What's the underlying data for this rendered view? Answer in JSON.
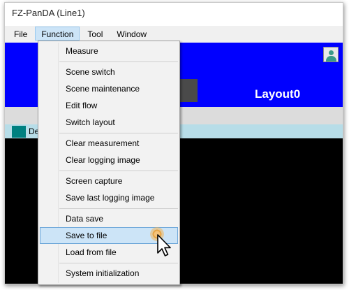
{
  "window": {
    "title": "FZ-PanDA (Line1)"
  },
  "menubar": {
    "items": [
      "File",
      "Function",
      "Tool",
      "Window"
    ],
    "open_item": "Function"
  },
  "app": {
    "layout_label": "Layout0",
    "tab_text": "De"
  },
  "function_menu": {
    "items": [
      "Measure",
      "Scene switch",
      "Scene maintenance",
      "Edit flow",
      "Switch layout",
      "Clear measurement",
      "Clear logging image",
      "Screen capture",
      "Save last logging image",
      "Data save",
      "Save to file",
      "Load from file",
      "System initialization"
    ],
    "highlighted": "Save to file"
  },
  "colors": {
    "app_background": "#0000ff",
    "menu_highlight": "#cce4f7",
    "tab_strip": "#b7dde8",
    "accent_teal": "#008080"
  },
  "icons": [
    "user-icon",
    "mouse-cursor-icon",
    "click-indicator-icon"
  ]
}
